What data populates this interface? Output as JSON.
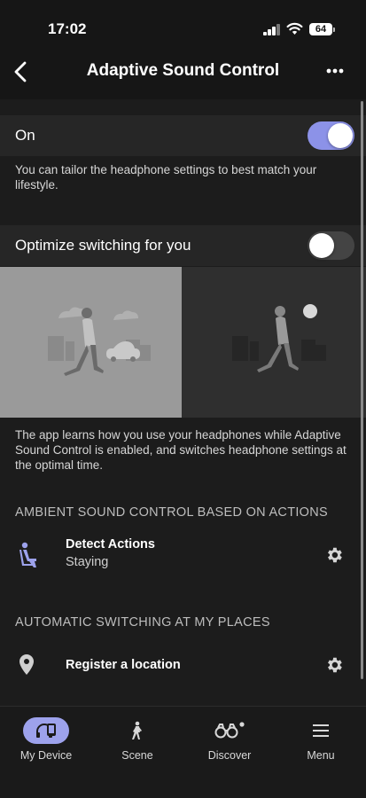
{
  "status_bar": {
    "time": "17:02",
    "battery": "64"
  },
  "header": {
    "title": "Adaptive Sound Control",
    "back_icon": "chevron-left-icon",
    "more_icon": "more-horizontal-icon"
  },
  "adaptive": {
    "label": "On",
    "enabled": true,
    "description": "You can tailor the headphone settings to best match your lifestyle."
  },
  "optimize": {
    "label": "Optimize switching for you",
    "enabled": false,
    "description": "The app learns how you use your headphones while Adaptive Sound Control is enabled, and switches headphone settings at the optimal time."
  },
  "ambient_section": {
    "title": "AMBIENT SOUND CONTROL BASED ON ACTIONS",
    "item": {
      "title": "Detect Actions",
      "subtitle": "Staying",
      "icon": "sitting-person-icon",
      "settings_icon": "gear-icon"
    }
  },
  "places_section": {
    "title": "AUTOMATIC SWITCHING AT MY PLACES",
    "item": {
      "title": "Register a location",
      "icon": "location-pin-icon",
      "settings_icon": "gear-icon"
    }
  },
  "tabs": [
    {
      "label": "My Device",
      "icon": "headphones-device-icon",
      "active": true
    },
    {
      "label": "Scene",
      "icon": "walking-person-icon",
      "active": false
    },
    {
      "label": "Discover",
      "icon": "binoculars-icon",
      "active": false
    },
    {
      "label": "Menu",
      "icon": "hamburger-menu-icon",
      "active": false
    }
  ],
  "colors": {
    "accent": "#8c92e8",
    "background": "#1c1c1c",
    "row": "#262626"
  }
}
